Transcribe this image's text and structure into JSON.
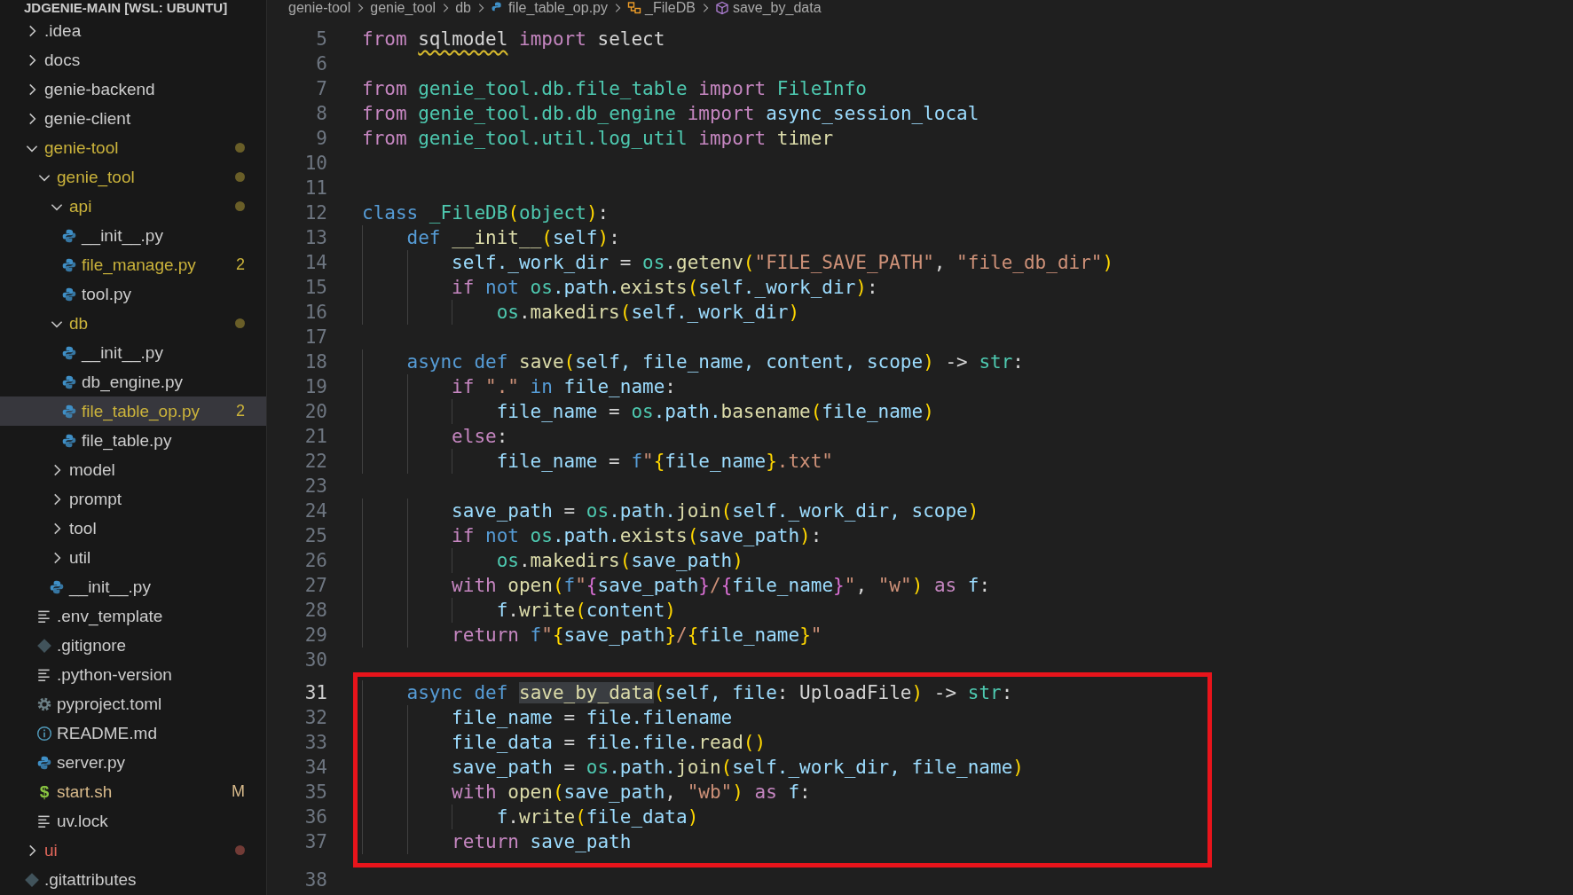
{
  "explorer": {
    "title": "JDGENIE-MAIN [WSL: UBUNTU]",
    "items": [
      {
        "label": ".idea",
        "kind": "folder",
        "expanded": false,
        "selected": false,
        "color": "#cccccc"
      },
      {
        "label": "docs",
        "kind": "folder",
        "expanded": false,
        "selected": false,
        "color": "#cccccc"
      },
      {
        "label": "genie-backend",
        "kind": "folder",
        "expanded": false,
        "selected": false,
        "color": "#cccccc"
      },
      {
        "label": "genie-client",
        "kind": "folder",
        "expanded": false,
        "selected": false,
        "color": "#cccccc"
      },
      {
        "label": "genie-tool",
        "kind": "folder",
        "expanded": true,
        "selected": false,
        "color": "#cbb33b",
        "dot": true,
        "children": [
          {
            "label": "genie_tool",
            "kind": "folder",
            "expanded": true,
            "selected": false,
            "color": "#cbb33b",
            "dot": true,
            "children": [
              {
                "label": "api",
                "kind": "folder",
                "expanded": true,
                "selected": false,
                "color": "#cbb33b",
                "dot": true,
                "children": [
                  {
                    "label": "__init__.py",
                    "kind": "python",
                    "selected": false,
                    "color": "#cccccc"
                  },
                  {
                    "label": "file_manage.py",
                    "kind": "python",
                    "selected": false,
                    "color": "#cbb33b",
                    "badge": "2"
                  },
                  {
                    "label": "tool.py",
                    "kind": "python",
                    "selected": false,
                    "color": "#cccccc"
                  }
                ]
              },
              {
                "label": "db",
                "kind": "folder",
                "expanded": true,
                "selected": false,
                "color": "#cbb33b",
                "dot": true,
                "children": [
                  {
                    "label": "__init__.py",
                    "kind": "python",
                    "selected": false,
                    "color": "#cccccc"
                  },
                  {
                    "label": "db_engine.py",
                    "kind": "python",
                    "selected": false,
                    "color": "#cccccc"
                  },
                  {
                    "label": "file_table_op.py",
                    "kind": "python",
                    "selected": true,
                    "color": "#cbb33b",
                    "badge": "2"
                  },
                  {
                    "label": "file_table.py",
                    "kind": "python",
                    "selected": false,
                    "color": "#cccccc"
                  }
                ]
              },
              {
                "label": "model",
                "kind": "folder",
                "expanded": false,
                "selected": false,
                "color": "#cccccc"
              },
              {
                "label": "prompt",
                "kind": "folder",
                "expanded": false,
                "selected": false,
                "color": "#cccccc"
              },
              {
                "label": "tool",
                "kind": "folder",
                "expanded": false,
                "selected": false,
                "color": "#cccccc"
              },
              {
                "label": "util",
                "kind": "folder",
                "expanded": false,
                "selected": false,
                "color": "#cccccc"
              },
              {
                "label": "__init__.py",
                "kind": "python",
                "selected": false,
                "color": "#cccccc"
              }
            ]
          },
          {
            "label": ".env_template",
            "kind": "text",
            "selected": false,
            "color": "#cccccc"
          },
          {
            "label": ".gitignore",
            "kind": "git",
            "selected": false,
            "color": "#cccccc"
          },
          {
            "label": ".python-version",
            "kind": "text",
            "selected": false,
            "color": "#cccccc"
          },
          {
            "label": "pyproject.toml",
            "kind": "gear",
            "selected": false,
            "color": "#cccccc"
          },
          {
            "label": "README.md",
            "kind": "info",
            "selected": false,
            "color": "#cccccc"
          },
          {
            "label": "server.py",
            "kind": "python",
            "selected": false,
            "color": "#cccccc"
          },
          {
            "label": "start.sh",
            "kind": "shell",
            "icon": "$",
            "selected": false,
            "color": "#d7b98a",
            "badge": "M"
          },
          {
            "label": "uv.lock",
            "kind": "text",
            "selected": false,
            "color": "#cccccc"
          }
        ]
      },
      {
        "label": "ui",
        "kind": "folder",
        "expanded": false,
        "selected": false,
        "color": "#e0665a",
        "dot": true
      },
      {
        "label": ".gitattributes",
        "kind": "git",
        "selected": false,
        "color": "#cccccc"
      }
    ]
  },
  "breadcrumbs": [
    {
      "label": "genie-tool",
      "kind": "folder"
    },
    {
      "label": "genie_tool",
      "kind": "folder"
    },
    {
      "label": "db",
      "kind": "folder"
    },
    {
      "label": "file_table_op.py",
      "kind": "python"
    },
    {
      "label": "_FileDB",
      "kind": "class"
    },
    {
      "label": "save_by_data",
      "kind": "method"
    }
  ],
  "editor": {
    "lines": [
      {
        "number": "5",
        "current": false,
        "tokens": [
          {
            "text": "from ",
            "kind": "keyword"
          },
          {
            "text": "sqlmodel",
            "kind": "warning"
          },
          {
            "text": " import",
            "kind": "keyword"
          },
          {
            "text": " select",
            "kind": "plain"
          }
        ]
      },
      {
        "number": "6",
        "current": false
      },
      {
        "number": "7",
        "current": false,
        "tokens": [
          {
            "text": "from",
            "kind": "keyword"
          },
          {
            "text": " genie_tool.db.file_table ",
            "kind": "module"
          },
          {
            "text": "import",
            "kind": "keyword"
          },
          {
            "text": " FileInfo",
            "kind": "module"
          }
        ]
      },
      {
        "number": "8",
        "current": false,
        "tokens": [
          {
            "text": "from",
            "kind": "keyword"
          },
          {
            "text": " genie_tool.db.db_engine ",
            "kind": "module"
          },
          {
            "text": "import",
            "kind": "keyword"
          },
          {
            "text": " async_session_local",
            "kind": "variable"
          }
        ]
      },
      {
        "number": "9",
        "current": false,
        "tokens": [
          {
            "text": "from",
            "kind": "keyword"
          },
          {
            "text": " genie_tool.util.log_util ",
            "kind": "module"
          },
          {
            "text": "import",
            "kind": "keyword"
          },
          {
            "text": " timer",
            "kind": "function"
          }
        ]
      },
      {
        "number": "10",
        "current": false
      },
      {
        "number": "11",
        "current": false
      },
      {
        "number": "12",
        "current": false,
        "tokens": [
          {
            "text": "class ",
            "kind": "storage"
          },
          {
            "text": "_FileDB",
            "kind": "module"
          },
          {
            "text": "(",
            "kind": "paren"
          },
          {
            "text": "object",
            "kind": "module"
          },
          {
            "text": ")",
            "kind": "paren"
          },
          {
            "text": ":",
            "kind": "plain"
          }
        ]
      },
      {
        "number": "13",
        "current": false,
        "tokens": [
          {
            "text": "    def ",
            "kind": "storage"
          },
          {
            "text": "__init__",
            "kind": "function"
          },
          {
            "text": "(",
            "kind": "paren"
          },
          {
            "text": "self",
            "kind": "variable"
          },
          {
            "text": ")",
            "kind": "paren"
          },
          {
            "text": ":",
            "kind": "plain"
          }
        ]
      },
      {
        "number": "14",
        "current": false,
        "tokens": [
          {
            "text": "        self._work_dir",
            "kind": "variable"
          },
          {
            "text": " = ",
            "kind": "plain"
          },
          {
            "text": "os",
            "kind": "module"
          },
          {
            "text": ".",
            "kind": "plain"
          },
          {
            "text": "getenv",
            "kind": "function"
          },
          {
            "text": "(",
            "kind": "paren"
          },
          {
            "text": "\"FILE_SAVE_PATH\"",
            "kind": "string"
          },
          {
            "text": ", ",
            "kind": "plain"
          },
          {
            "text": "\"file_db_dir\"",
            "kind": "string"
          },
          {
            "text": ")",
            "kind": "paren"
          }
        ]
      },
      {
        "number": "15",
        "current": false,
        "tokens": [
          {
            "text": "        if ",
            "kind": "keyword"
          },
          {
            "text": "not ",
            "kind": "storage"
          },
          {
            "text": "os",
            "kind": "module"
          },
          {
            "text": ".path.",
            "kind": "variable"
          },
          {
            "text": "exists",
            "kind": "function"
          },
          {
            "text": "(",
            "kind": "paren"
          },
          {
            "text": "self._work_dir",
            "kind": "variable"
          },
          {
            "text": ")",
            "kind": "paren"
          },
          {
            "text": ":",
            "kind": "plain"
          }
        ]
      },
      {
        "number": "16",
        "current": false,
        "tokens": [
          {
            "text": "            os",
            "kind": "module"
          },
          {
            "text": ".",
            "kind": "plain"
          },
          {
            "text": "makedirs",
            "kind": "function"
          },
          {
            "text": "(",
            "kind": "paren"
          },
          {
            "text": "self._work_dir",
            "kind": "variable"
          },
          {
            "text": ")",
            "kind": "paren"
          }
        ]
      },
      {
        "number": "17",
        "current": false
      },
      {
        "number": "18",
        "current": false,
        "tokens": [
          {
            "text": "    async def ",
            "kind": "storage"
          },
          {
            "text": "save",
            "kind": "function"
          },
          {
            "text": "(",
            "kind": "paren"
          },
          {
            "text": "self, file_name, content, scope",
            "kind": "variable"
          },
          {
            "text": ")",
            "kind": "paren"
          },
          {
            "text": " -> ",
            "kind": "plain"
          },
          {
            "text": "str",
            "kind": "module"
          },
          {
            "text": ":",
            "kind": "plain"
          }
        ]
      },
      {
        "number": "19",
        "current": false,
        "tokens": [
          {
            "text": "        if ",
            "kind": "keyword"
          },
          {
            "text": "\".\" ",
            "kind": "string"
          },
          {
            "text": "in",
            "kind": "storage"
          },
          {
            "text": " file_name",
            "kind": "variable"
          },
          {
            "text": ":",
            "kind": "plain"
          }
        ]
      },
      {
        "number": "20",
        "current": false,
        "tokens": [
          {
            "text": "            file_name",
            "kind": "variable"
          },
          {
            "text": " = ",
            "kind": "plain"
          },
          {
            "text": "os",
            "kind": "module"
          },
          {
            "text": ".path.",
            "kind": "variable"
          },
          {
            "text": "basename",
            "kind": "function"
          },
          {
            "text": "(",
            "kind": "paren"
          },
          {
            "text": "file_name",
            "kind": "variable"
          },
          {
            "text": ")",
            "kind": "paren"
          }
        ]
      },
      {
        "number": "21",
        "current": false,
        "tokens": [
          {
            "text": "        else",
            "kind": "keyword"
          },
          {
            "text": ":",
            "kind": "plain"
          }
        ]
      },
      {
        "number": "22",
        "current": false,
        "tokens": [
          {
            "text": "            file_name",
            "kind": "variable"
          },
          {
            "text": " = ",
            "kind": "plain"
          },
          {
            "text": "f",
            "kind": "storage"
          },
          {
            "text": "\"",
            "kind": "string"
          },
          {
            "text": "{",
            "kind": "paren"
          },
          {
            "text": "file_name",
            "kind": "variable"
          },
          {
            "text": "}",
            "kind": "paren"
          },
          {
            "text": ".txt\"",
            "kind": "string"
          }
        ]
      },
      {
        "number": "23",
        "current": false
      },
      {
        "number": "24",
        "current": false,
        "tokens": [
          {
            "text": "        save_path",
            "kind": "variable"
          },
          {
            "text": " = ",
            "kind": "plain"
          },
          {
            "text": "os",
            "kind": "module"
          },
          {
            "text": ".path.",
            "kind": "variable"
          },
          {
            "text": "join",
            "kind": "function"
          },
          {
            "text": "(",
            "kind": "paren"
          },
          {
            "text": "self._work_dir, scope",
            "kind": "variable"
          },
          {
            "text": ")",
            "kind": "paren"
          }
        ]
      },
      {
        "number": "25",
        "current": false,
        "tokens": [
          {
            "text": "        if ",
            "kind": "keyword"
          },
          {
            "text": "not ",
            "kind": "storage"
          },
          {
            "text": "os",
            "kind": "module"
          },
          {
            "text": ".path.",
            "kind": "variable"
          },
          {
            "text": "exists",
            "kind": "function"
          },
          {
            "text": "(",
            "kind": "paren"
          },
          {
            "text": "save_path",
            "kind": "variable"
          },
          {
            "text": ")",
            "kind": "paren"
          },
          {
            "text": ":",
            "kind": "plain"
          }
        ]
      },
      {
        "number": "26",
        "current": false,
        "tokens": [
          {
            "text": "            os",
            "kind": "module"
          },
          {
            "text": ".",
            "kind": "plain"
          },
          {
            "text": "makedirs",
            "kind": "function"
          },
          {
            "text": "(",
            "kind": "paren"
          },
          {
            "text": "save_path",
            "kind": "variable"
          },
          {
            "text": ")",
            "kind": "paren"
          }
        ]
      },
      {
        "number": "27",
        "current": false,
        "tokens": [
          {
            "text": "        with ",
            "kind": "keyword"
          },
          {
            "text": "open",
            "kind": "function"
          },
          {
            "text": "(",
            "kind": "paren"
          },
          {
            "text": "f",
            "kind": "storage"
          },
          {
            "text": "\"",
            "kind": "string"
          },
          {
            "text": "{",
            "kind": "brace"
          },
          {
            "text": "save_path",
            "kind": "variable"
          },
          {
            "text": "}",
            "kind": "brace"
          },
          {
            "text": "/",
            "kind": "string"
          },
          {
            "text": "{",
            "kind": "brace"
          },
          {
            "text": "file_name",
            "kind": "variable"
          },
          {
            "text": "}",
            "kind": "brace"
          },
          {
            "text": "\"",
            "kind": "string"
          },
          {
            "text": ", ",
            "kind": "plain"
          },
          {
            "text": "\"w\"",
            "kind": "string"
          },
          {
            "text": ") ",
            "kind": "paren"
          },
          {
            "text": "as",
            "kind": "keyword"
          },
          {
            "text": " f",
            "kind": "variable"
          },
          {
            "text": ":",
            "kind": "plain"
          }
        ]
      },
      {
        "number": "28",
        "current": false,
        "tokens": [
          {
            "text": "            f",
            "kind": "variable"
          },
          {
            "text": ".",
            "kind": "plain"
          },
          {
            "text": "write",
            "kind": "function"
          },
          {
            "text": "(",
            "kind": "paren"
          },
          {
            "text": "content",
            "kind": "variable"
          },
          {
            "text": ")",
            "kind": "paren"
          }
        ]
      },
      {
        "number": "29",
        "current": false,
        "tokens": [
          {
            "text": "        return ",
            "kind": "keyword"
          },
          {
            "text": "f",
            "kind": "storage"
          },
          {
            "text": "\"",
            "kind": "string"
          },
          {
            "text": "{",
            "kind": "paren"
          },
          {
            "text": "save_path",
            "kind": "variable"
          },
          {
            "text": "}",
            "kind": "paren"
          },
          {
            "text": "/",
            "kind": "string"
          },
          {
            "text": "{",
            "kind": "paren"
          },
          {
            "text": "file_name",
            "kind": "variable"
          },
          {
            "text": "}",
            "kind": "paren"
          },
          {
            "text": "\"",
            "kind": "string"
          }
        ]
      },
      {
        "number": "30",
        "current": false
      }
    ],
    "boxed_lines": [
      {
        "number": "31",
        "current": true,
        "tokens": [
          {
            "text": "    async def ",
            "kind": "storage"
          },
          {
            "text": "save_by_data",
            "kind": "match"
          },
          {
            "text": "(",
            "kind": "paren"
          },
          {
            "text": "self, file",
            "kind": "variable"
          },
          {
            "text": ": UploadFile",
            "kind": "plain"
          },
          {
            "text": ")",
            "kind": "paren"
          },
          {
            "text": " -> ",
            "kind": "plain"
          },
          {
            "text": "str",
            "kind": "module"
          },
          {
            "text": ":",
            "kind": "plain"
          }
        ]
      },
      {
        "number": "32",
        "current": false,
        "tokens": [
          {
            "text": "        file_name",
            "kind": "variable"
          },
          {
            "text": " = ",
            "kind": "plain"
          },
          {
            "text": "file.filename",
            "kind": "variable"
          }
        ]
      },
      {
        "number": "33",
        "current": false,
        "tokens": [
          {
            "text": "        file_data",
            "kind": "variable"
          },
          {
            "text": " = ",
            "kind": "plain"
          },
          {
            "text": "file.file.",
            "kind": "variable"
          },
          {
            "text": "read",
            "kind": "function"
          },
          {
            "text": "()",
            "kind": "paren"
          }
        ]
      },
      {
        "number": "34",
        "current": false,
        "tokens": [
          {
            "text": "        save_path",
            "kind": "variable"
          },
          {
            "text": " = ",
            "kind": "plain"
          },
          {
            "text": "os",
            "kind": "module"
          },
          {
            "text": ".path.",
            "kind": "variable"
          },
          {
            "text": "join",
            "kind": "function"
          },
          {
            "text": "(",
            "kind": "paren"
          },
          {
            "text": "self._work_dir, file_name",
            "kind": "variable"
          },
          {
            "text": ")",
            "kind": "paren"
          }
        ]
      },
      {
        "number": "35",
        "current": false,
        "tokens": [
          {
            "text": "        with ",
            "kind": "keyword"
          },
          {
            "text": "open",
            "kind": "function"
          },
          {
            "text": "(",
            "kind": "paren"
          },
          {
            "text": "save_path",
            "kind": "variable"
          },
          {
            "text": ", ",
            "kind": "plain"
          },
          {
            "text": "\"wb\"",
            "kind": "string"
          },
          {
            "text": ") ",
            "kind": "paren"
          },
          {
            "text": "as",
            "kind": "keyword"
          },
          {
            "text": " f",
            "kind": "variable"
          },
          {
            "text": ":",
            "kind": "plain"
          }
        ]
      },
      {
        "number": "36",
        "current": false,
        "tokens": [
          {
            "text": "            f",
            "kind": "variable"
          },
          {
            "text": ".",
            "kind": "plain"
          },
          {
            "text": "write",
            "kind": "function"
          },
          {
            "text": "(",
            "kind": "paren"
          },
          {
            "text": "file_data",
            "kind": "variable"
          },
          {
            "text": ")",
            "kind": "paren"
          }
        ]
      },
      {
        "number": "37",
        "current": false,
        "tokens": [
          {
            "text": "        return",
            "kind": "keyword"
          },
          {
            "text": " save_path",
            "kind": "variable"
          }
        ]
      }
    ],
    "after_lines": [
      {
        "number": "38",
        "current": false
      }
    ]
  }
}
